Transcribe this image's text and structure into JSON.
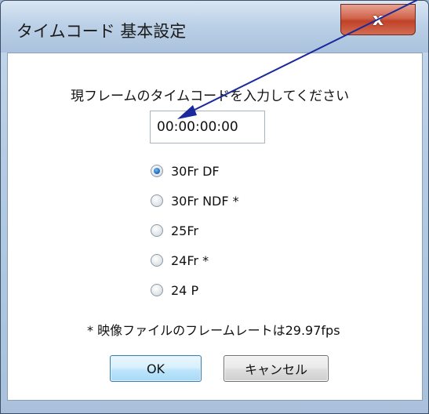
{
  "window": {
    "title": "タイムコード 基本設定",
    "close_label": "x"
  },
  "dialog": {
    "prompt": "現フレームのタイムコードを入力してください",
    "timecode_value": "00:00:00:00",
    "options": [
      {
        "label": "30Fr DF",
        "checked": true
      },
      {
        "label": "30Fr NDF *",
        "checked": false
      },
      {
        "label": "25Fr",
        "checked": false
      },
      {
        "label": "24Fr *",
        "checked": false
      },
      {
        "label": "24 P",
        "checked": false
      }
    ],
    "note": "* 映像ファイルのフレームレートは29.97fps",
    "ok_label": "OK",
    "cancel_label": "キャンセル"
  },
  "colors": {
    "annotation_arrow": "#1a2a9c",
    "radio_selected": "#1f6fc4",
    "close_button": "#c04228"
  }
}
